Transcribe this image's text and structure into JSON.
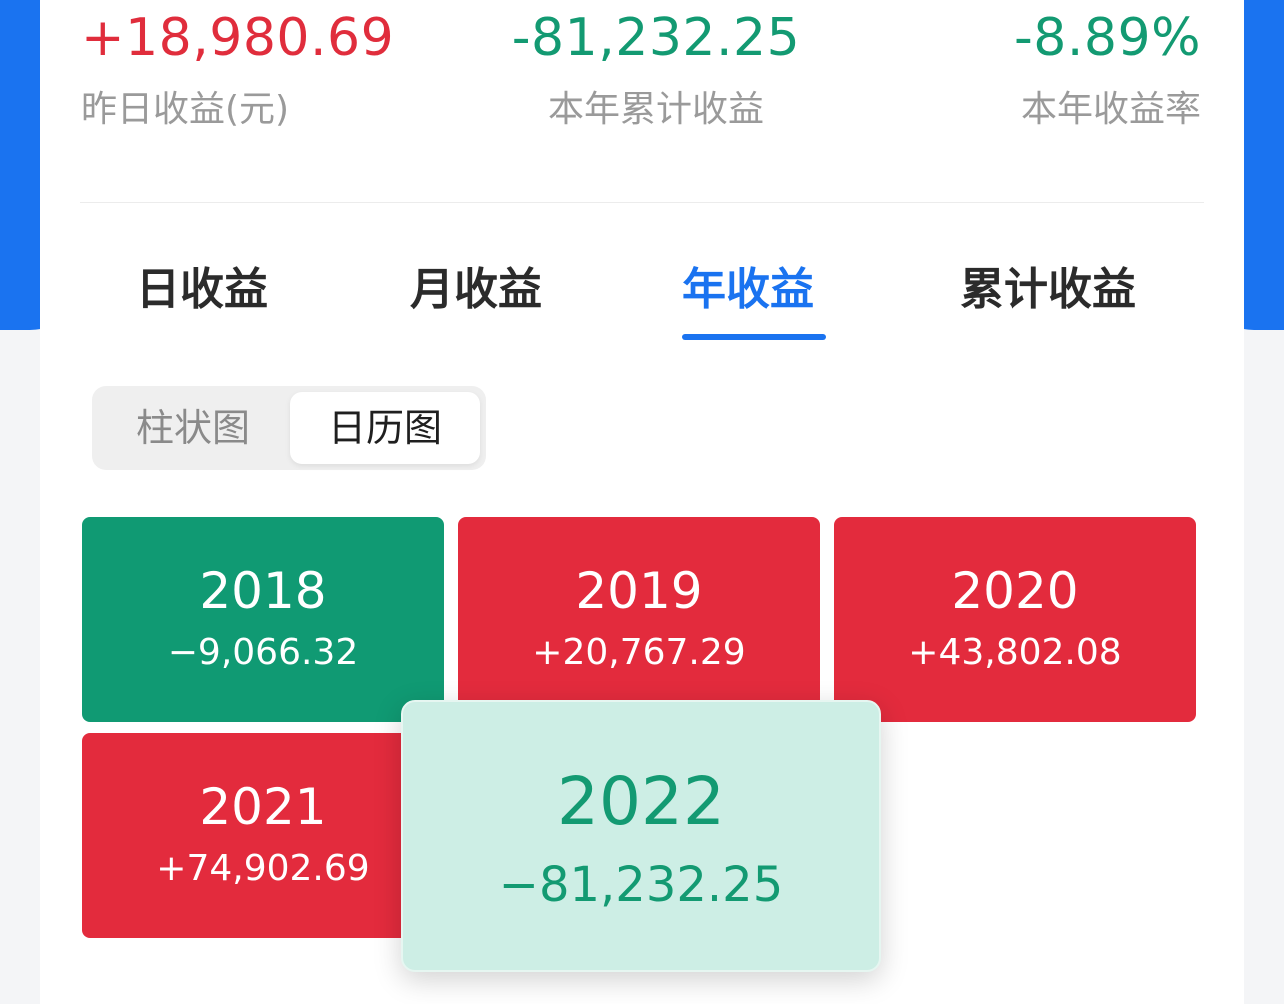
{
  "summary": {
    "yesterday_value": "+18,980.69",
    "yesterday_label": "昨日收益(元)",
    "year_total_value": "-81,232.25",
    "year_total_label": "本年累计收益",
    "year_rate_value": "-8.89%",
    "year_rate_label": "本年收益率"
  },
  "tabs": [
    {
      "label": "日收益",
      "active": false
    },
    {
      "label": "月收益",
      "active": false
    },
    {
      "label": "年收益",
      "active": true
    },
    {
      "label": "累计收益",
      "active": false
    }
  ],
  "view_toggle": {
    "bar_label": "柱状图",
    "calendar_label": "日历图",
    "selected": "日历图"
  },
  "years": [
    {
      "year": "2018",
      "amount": "−9,066.32",
      "trend": "down"
    },
    {
      "year": "2019",
      "amount": "+20,767.29",
      "trend": "up"
    },
    {
      "year": "2020",
      "amount": "+43,802.08",
      "trend": "up"
    },
    {
      "year": "2021",
      "amount": "+74,902.69",
      "trend": "up"
    },
    {
      "year": "2022",
      "amount": "−81,232.25",
      "trend": "down",
      "highlighted": true
    }
  ],
  "colors": {
    "accent": "#1a73f0",
    "gain": "#e02d3c",
    "loss": "#139a72",
    "highlight_bg": "#cdeee5"
  }
}
